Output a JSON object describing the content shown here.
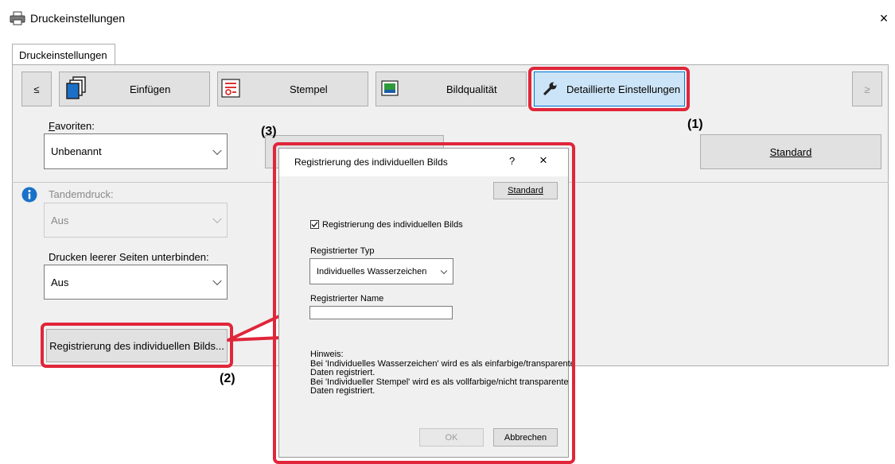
{
  "window": {
    "title": "Druckeinstellungen",
    "close": "×"
  },
  "tabs": [
    {
      "label": "Druckeinstellungen"
    }
  ],
  "toolbar": {
    "prev": "≤",
    "next": "≥",
    "items": [
      {
        "label": "Einfügen"
      },
      {
        "label": "Stempel"
      },
      {
        "label": "Bildqualität"
      },
      {
        "label": "Detaillierte Einstellungen"
      }
    ]
  },
  "favorites": {
    "label": "Favoriten:",
    "value": "Unbenannt",
    "standard_button": "Standard"
  },
  "tandem": {
    "label": "Tandemdruck:",
    "value": "Aus"
  },
  "blank_pages": {
    "label": "Drucken leerer Seiten unterbinden:",
    "value": "Aus"
  },
  "register_button": "Registrierung des individuellen Bilds...",
  "callouts": {
    "c1": "(1)",
    "c2": "(2)",
    "c3": "(3)"
  },
  "dialog": {
    "title": "Registrierung des individuellen Bilds",
    "help": "?",
    "close": "×",
    "standard_button": "Standard",
    "checkbox_label": "Registrierung des individuellen Bilds",
    "checkbox_checked": true,
    "type_label": "Registrierter Typ",
    "type_value": "Individuelles Wasserzeichen",
    "name_label": "Registrierter Name",
    "name_value": "",
    "note_heading": "Hinweis:",
    "note_line1": "Bei 'Individuelles Wasserzeichen' wird es als einfarbige/transparente",
    "note_line2": "Daten registriert.",
    "note_line3": "Bei 'Individueller Stempel' wird es als vollfarbige/nicht transparente",
    "note_line4": "Daten registriert.",
    "ok_button": "OK",
    "cancel_button": "Abbrechen"
  },
  "colors": {
    "highlight": "#e0263a",
    "info_icon": "#1a72c8"
  }
}
